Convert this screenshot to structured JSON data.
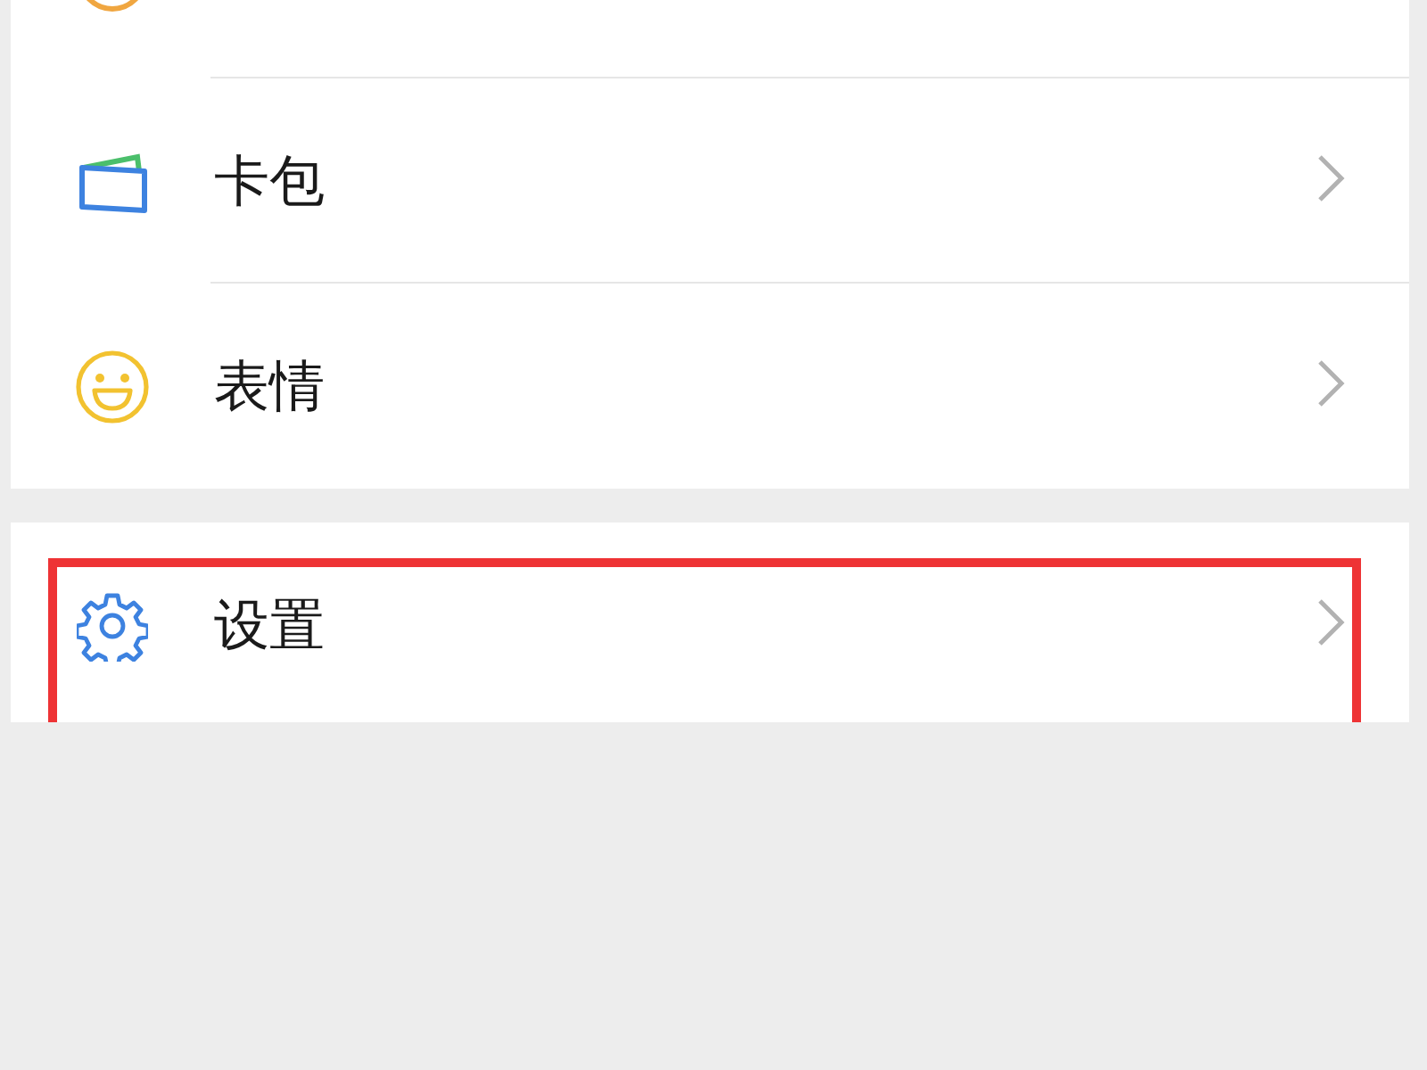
{
  "groups": [
    {
      "items": [
        {
          "kind": "ring",
          "highlighted": false
        },
        {
          "kind": "wallet",
          "label": "卡包",
          "highlighted": false
        },
        {
          "kind": "smile",
          "label": "表情",
          "highlighted": false
        }
      ]
    },
    {
      "items": [
        {
          "kind": "gear",
          "label": "设置",
          "highlighted": true
        }
      ]
    }
  ]
}
